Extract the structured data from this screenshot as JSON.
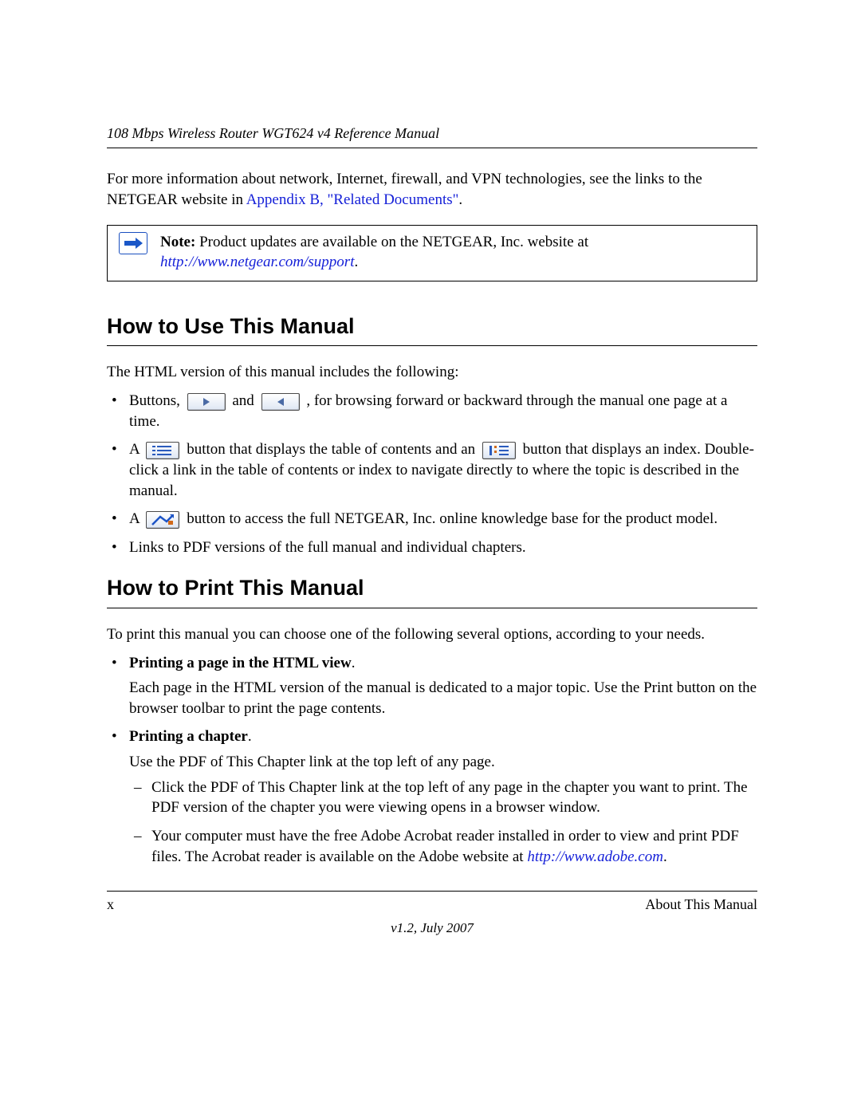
{
  "header": {
    "title": "108 Mbps Wireless Router WGT624 v4 Reference Manual"
  },
  "intro": {
    "prefix": "For more information about network, Internet, firewall, and VPN technologies, see the links to the NETGEAR website in ",
    "link_text": "Appendix B, \"Related Documents\"",
    "suffix": "."
  },
  "note": {
    "label": "Note:",
    "text": " Product updates are available on the NETGEAR, Inc. website at ",
    "link": "http://www.netgear.com/support",
    "suffix": "."
  },
  "section1": {
    "heading": "How to Use This Manual",
    "lead": "The HTML version of this manual includes the following:",
    "bullets": {
      "b1_a": "Buttons, ",
      "b1_b": " and ",
      "b1_c": ", for browsing forward or backward through the manual one page at a time.",
      "b2_a": "A ",
      "b2_b": " button that displays the table of contents and an ",
      "b2_c": " button that displays an index. Double-click a link in the table of contents or index to navigate directly to where the topic is described in the manual.",
      "b3_a": "A ",
      "b3_b": " button to access the full NETGEAR, Inc. online knowledge base for the product model.",
      "b4": "Links to PDF versions of the full manual and individual chapters."
    }
  },
  "section2": {
    "heading": "How to Print This Manual",
    "lead": "To print this manual you can choose one of the following several options, according to your needs.",
    "items": {
      "p1_title": "Printing a page in the HTML view",
      "p1_body": "Each page in the HTML version of the manual is dedicated to a major topic. Use the Print button on the browser toolbar to print the page contents.",
      "p2_title": "Printing a chapter",
      "p2_body": "Use the PDF of This Chapter link at the top left of any page.",
      "p2_d1": "Click the PDF of This Chapter link at the top left of any page in the chapter you want to print. The PDF version of the chapter you were viewing opens in a browser window.",
      "p2_d2_a": "Your computer must have the free Adobe Acrobat reader installed in order to view and print PDF files. The Acrobat reader is available on the Adobe website at ",
      "p2_d2_link": "http://www.adobe.com",
      "p2_d2_b": "."
    }
  },
  "footer": {
    "page_num": "x",
    "section": "About This Manual",
    "version": "v1.2, July 2007"
  }
}
